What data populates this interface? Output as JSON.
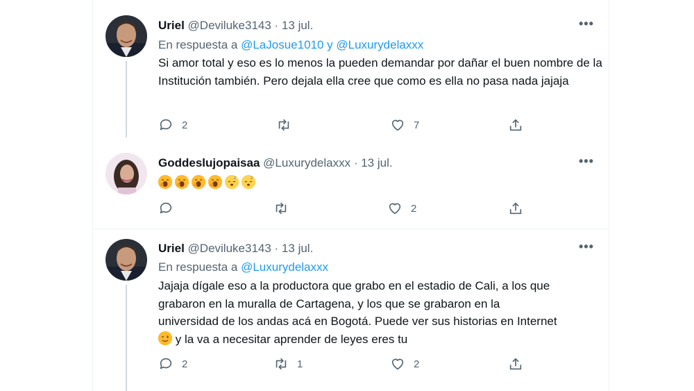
{
  "tweets": [
    {
      "name": "Uriel",
      "handle": "@Deviluke3143",
      "date": "· 13 jul.",
      "reply_prefix": "En respuesta a",
      "reply_to": "@LaJosue1010 y @Luxurydelaxxx",
      "text": "Si amor total y eso es lo menos la pueden demandar por dañar el buen nombre de la Institución también. Pero dejala ella cree que como es ella no pasa nada jajaja",
      "replies": "2",
      "retweets": "",
      "likes": "7"
    },
    {
      "name": "Goddeslujopaisaa",
      "handle": "@Luxurydelaxxx",
      "date": "· 13 jul.",
      "emojis": [
        "yawning-face",
        "yawning-face",
        "yawning-face",
        "yawning-face",
        "sleeping-face",
        "sleeping-face"
      ],
      "replies": "",
      "retweets": "",
      "likes": "2"
    },
    {
      "name": "Uriel",
      "handle": "@Deviluke3143",
      "date": "· 13 jul.",
      "reply_prefix": "En respuesta a",
      "reply_to": "@Luxurydelaxxx",
      "text_lines": [
        "Jajaja dígale eso a la productora que grabo en el estadio de Cali, a los que",
        "grabaron en la muralla de Cartagena, y los que se grabaron en la",
        "universidad de los andas acá en Bogotá. Puede ver sus historias en Internet"
      ],
      "text_tail": "y la va a necesitar aprender de leyes eres tu",
      "replies": "2",
      "retweets": "1",
      "likes": "2"
    }
  ],
  "more_glyph": "•••",
  "colors": {
    "accent": "#1d9bf0",
    "muted": "#536471",
    "text": "#0f1419"
  }
}
